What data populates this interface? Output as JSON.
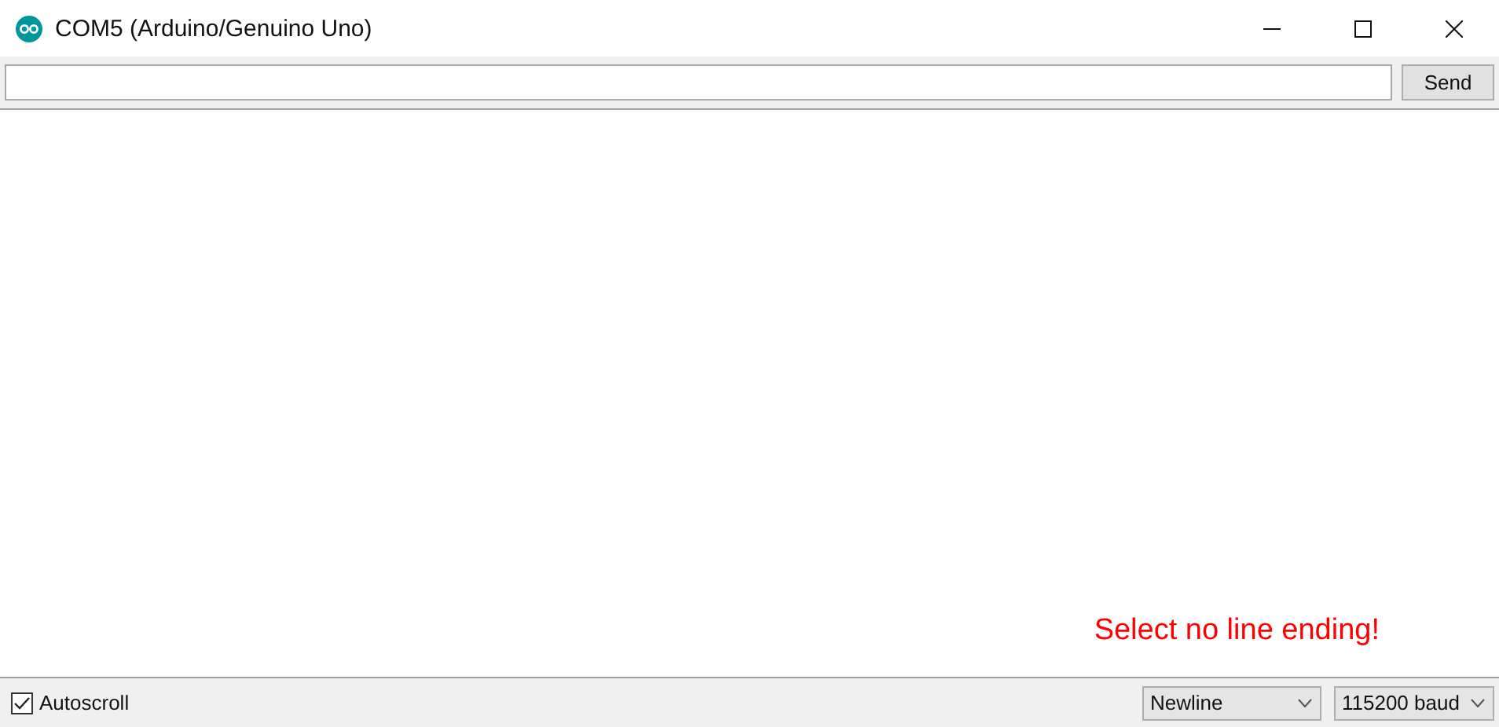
{
  "window": {
    "title": "COM5 (Arduino/Genuino Uno)"
  },
  "send_bar": {
    "button": "Send"
  },
  "output": {
    "annotation": "Select no line ending!"
  },
  "footer": {
    "autoscroll": {
      "label": "Autoscroll",
      "checked": true
    },
    "line_ending": {
      "value": "Newline"
    },
    "baud_rate": {
      "value": "115200 baud"
    }
  }
}
